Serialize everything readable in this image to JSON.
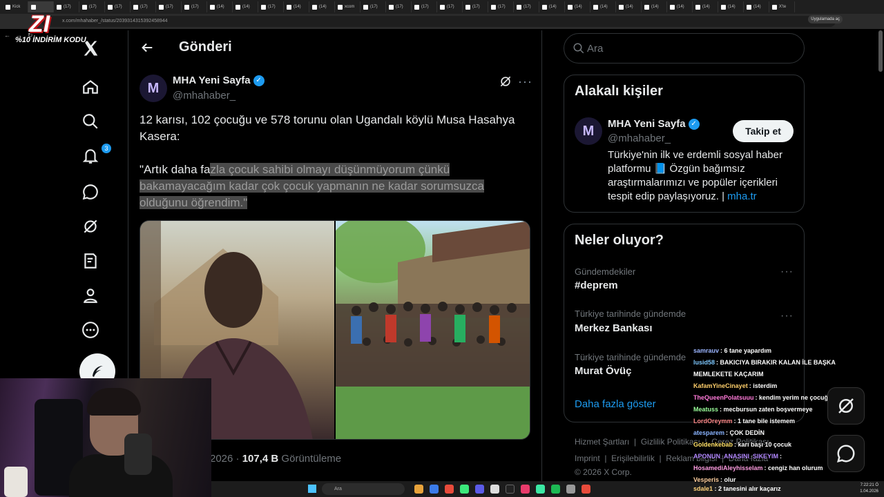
{
  "browser": {
    "tabs": [
      "Kick",
      "",
      "(17)",
      "(17)",
      "(17)",
      "(17)",
      "(17)",
      "(17)",
      "(14)",
      "(14)",
      "(17)",
      "(14)",
      "(14)",
      "xcom",
      "(17)",
      "(17)",
      "(17)",
      "(17)",
      "(17)",
      "(17)",
      "(17)",
      "(14)",
      "(14)",
      "(14)",
      "(14)",
      "(14)",
      "(14)",
      "(14)",
      "(14)",
      "(14)",
      "X'te"
    ],
    "url": "x.com/mhahaber_/status/2039314315392458944",
    "app_pill": "Uygulamada aç"
  },
  "overlay": {
    "logo_text": "ZI",
    "promo": "%10 İNDİRİM KODU"
  },
  "nav": {
    "notifications_badge": "3"
  },
  "main": {
    "header_title": "Gönderi",
    "author": {
      "name": "MHA Yeni Sayfa",
      "handle": "@mhahaber_",
      "avatar_letter": "M"
    },
    "tweet_text": "12 karısı, 102 çocuğu ve 578 torunu olan Ugandalı köylü Musa Hasahya Kasera:",
    "quote_plain": "\"Artık daha fa",
    "quote_highlighted": "zla çocuk sahibi olmayı düşünmüyorum çünkü bakamayacağım kadar çok çocuk yapmanın ne kadar sorumsuzca olduğunu öğrendim.\"",
    "stats_date": "2026",
    "stats_sep": " · ",
    "stats_views": "107,4 B",
    "stats_label": " Görüntüleme"
  },
  "right": {
    "search_placeholder": "Ara",
    "related": {
      "title": "Alakalı kişiler",
      "name": "MHA Yeni Sayfa",
      "handle": "@mhahaber_",
      "follow": "Takip et",
      "bio": "Türkiye'nin ilk ve erdemli sosyal haber platformu 📘 Özgün bağımsız araştırmalarımızı ve popüler içerikleri tespit edip paylaşıyoruz. | ",
      "bio_link": "mha.tr"
    },
    "trends": {
      "title": "Neler oluyor?",
      "items": [
        {
          "category": "Gündemdekiler",
          "name": "#deprem"
        },
        {
          "category": "Türkiye tarihinde gündemde",
          "name": "Merkez Bankası"
        },
        {
          "category": "Türkiye tarihinde gündemde",
          "name": "Murat Övüç"
        }
      ],
      "show_more": "Daha fazla göster"
    },
    "footer": {
      "line1": [
        "Hizmet Şartları",
        "Gizlilik Politikası",
        "Çerez Politikası"
      ],
      "line2": [
        "Imprint",
        "Erişilebilirlik",
        "Reklam bilgisi",
        "Daha fazla"
      ],
      "copyright": "© 2026 X Corp."
    }
  },
  "chat": [
    {
      "user": "samrauv",
      "color": "#9bb5ff",
      "msg": "6 tane yapardım"
    },
    {
      "user": "lusid58",
      "color": "#7ec8ff",
      "msg": "BAKICIYA BIRAKIR KALAN İLE BAŞKA MEMLEKETE KAÇARIM"
    },
    {
      "user": "KafamYineCinayet",
      "color": "#ffcf6b",
      "msg": "isterdim"
    },
    {
      "user": "TheQueenPolatsuuu",
      "color": "#ff7ad9",
      "msg": "kendim yerim ne çocuğu"
    },
    {
      "user": "Meatuss",
      "color": "#9bff9b",
      "msg": "mecbursun zaten boşvermeye"
    },
    {
      "user": "LordOreymm",
      "color": "#ff8a8a",
      "msg": "1 tane bile istemem"
    },
    {
      "user": "atesparem",
      "color": "#8ab4ff",
      "msg": "ÇOK DEDİN"
    },
    {
      "user": "Goldenkebab",
      "color": "#ffe066",
      "msg": "karı başı 10 çocuk"
    },
    {
      "user": "APONUN_ANASINI_SIKEYIM",
      "color": "#b388ff",
      "msg": ""
    },
    {
      "user": "HosamediAleyhisselam",
      "color": "#ff9de2",
      "msg": "cengiz han olurum"
    },
    {
      "user": "Vesperis",
      "color": "#ffd0a0",
      "msg": "olur"
    }
  ],
  "chat_bottom": {
    "user": "sdale1",
    "msg": "2 tanesini alır kaçarız"
  },
  "taskbar": {
    "search": "Ara",
    "time": "7:22:21 Ö",
    "date": "1.04.2026"
  },
  "colors": {
    "accent": "#1d9bf0",
    "background": "#000000",
    "border": "#2f3336",
    "muted": "#71767b"
  }
}
